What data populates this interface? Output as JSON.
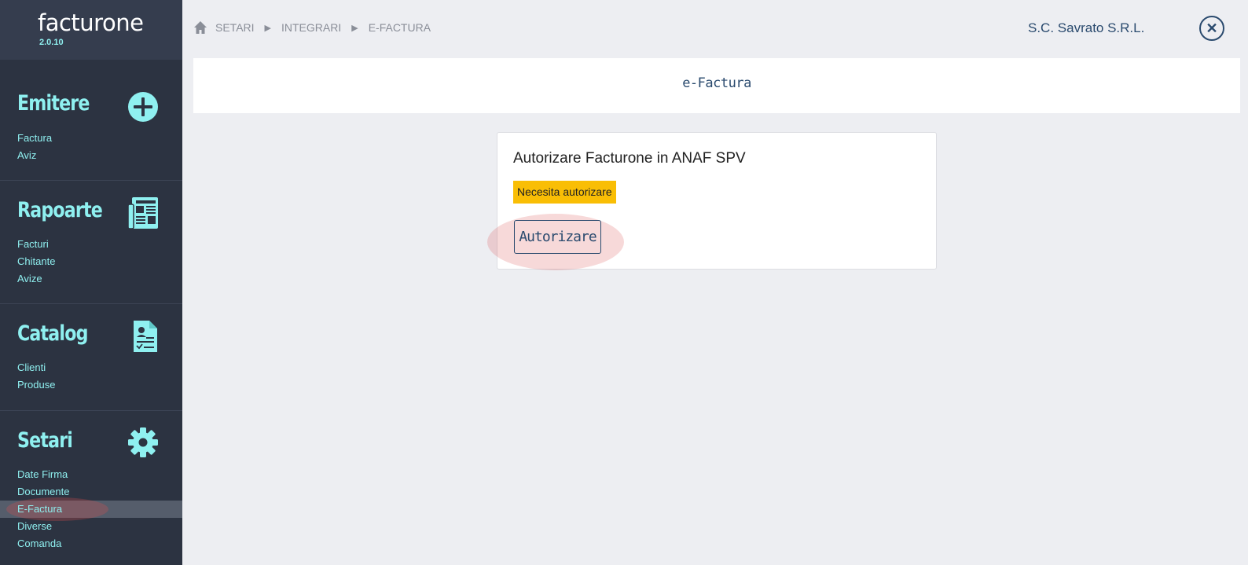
{
  "app": {
    "logo": "facturone",
    "version": "2.0.10"
  },
  "sidebar": {
    "sections": [
      {
        "title": "Emitere",
        "icon": "plus-circle-icon",
        "items": [
          "Factura",
          "Aviz"
        ]
      },
      {
        "title": "Rapoarte",
        "icon": "newspaper-icon",
        "items": [
          "Facturi",
          "Chitante",
          "Avize"
        ]
      },
      {
        "title": "Catalog",
        "icon": "contract-document-icon",
        "items": [
          "Clienti",
          "Produse"
        ]
      },
      {
        "title": "Setari",
        "icon": "gear-icon",
        "items": [
          "Date Firma",
          "Documente",
          "E-Factura",
          "Diverse",
          "Comanda"
        ]
      }
    ],
    "active_item": "E-Factura"
  },
  "topbar": {
    "breadcrumb": [
      "SETARI",
      "INTEGRARI",
      "E-FACTURA"
    ],
    "company": "S.C. Savrato S.R.L."
  },
  "page": {
    "title": "e-Factura"
  },
  "card": {
    "title": "Autorizare Facturone in ANAF SPV",
    "status": "Necesita autorizare",
    "button": "Autorizare"
  },
  "colors": {
    "sidebar_bg": "#2c3341",
    "accent_cyan": "#8ff0f0",
    "text_navy": "#2a4a6e",
    "status_yellow": "#f9be05",
    "page_bg": "#edeef2"
  }
}
